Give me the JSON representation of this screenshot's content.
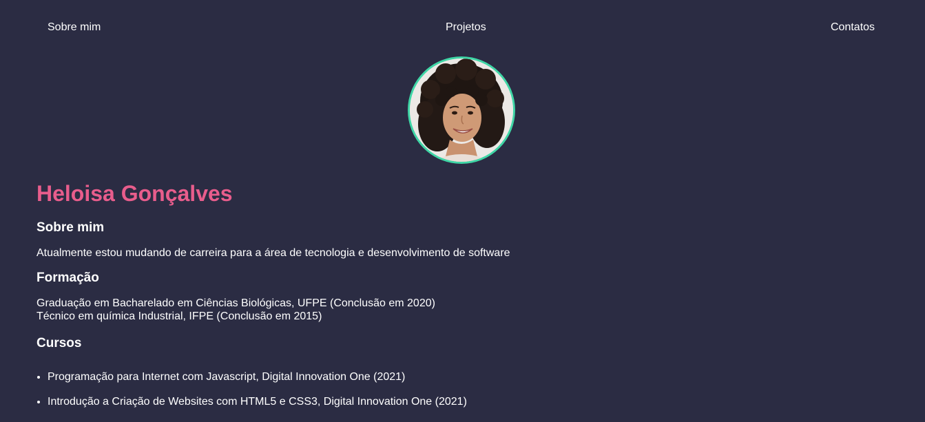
{
  "nav": {
    "items": [
      {
        "label": "Sobre mim"
      },
      {
        "label": "Projetos"
      },
      {
        "label": "Contatos"
      }
    ]
  },
  "profile": {
    "name": "Heloisa Gonçalves",
    "accent_color": "#e85d8c",
    "avatar_border_color": "#3fd6a6",
    "background_color": "#2b2c43"
  },
  "about": {
    "heading": "Sobre mim",
    "text": "Atualmente estou mudando de carreira para a área de tecnologia e desenvolvimento de software"
  },
  "education": {
    "heading": "Formação",
    "items": [
      "Graduação em Bacharelado em Ciências Biológicas, UFPE (Conclusão em 2020)",
      "Técnico em química Industrial, IFPE (Conclusão em 2015)"
    ]
  },
  "courses": {
    "heading": "Cursos",
    "items": [
      "Programação para Internet com Javascript, Digital Innovation One (2021)",
      "Introdução a Criação de Websites com HTML5 e CSS3, Digital Innovation One (2021)"
    ]
  }
}
